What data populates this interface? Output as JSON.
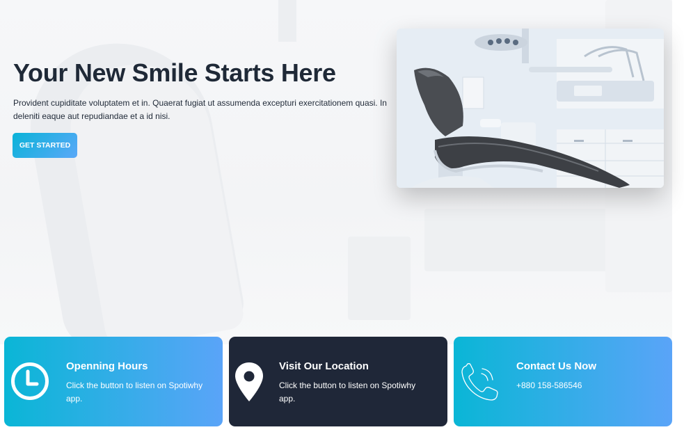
{
  "hero": {
    "title": "Your New Smile Starts Here",
    "description": "Provident cupiditate voluptatem et in. Quaerat fugiat ut assumenda excepturi exercitationem quasi. In deleniti eaque aut repudiandae et a id nisi.",
    "cta_label": "GET STARTED"
  },
  "cards": [
    {
      "title": "Openning Hours",
      "text": "Click the button to listen on Spotiwhy app.",
      "icon": "clock-icon"
    },
    {
      "title": "Visit Our Location",
      "text": "Click the button to listen on Spotiwhy app.",
      "icon": "map-pin-icon"
    },
    {
      "title": "Contact Us Now",
      "text": "+880 158-586546",
      "icon": "phone-icon"
    }
  ],
  "colors": {
    "accent_start": "#0ab6d6",
    "accent_end": "#5aa4f8",
    "dark_card": "#1f2738",
    "heading": "#1f2937"
  }
}
